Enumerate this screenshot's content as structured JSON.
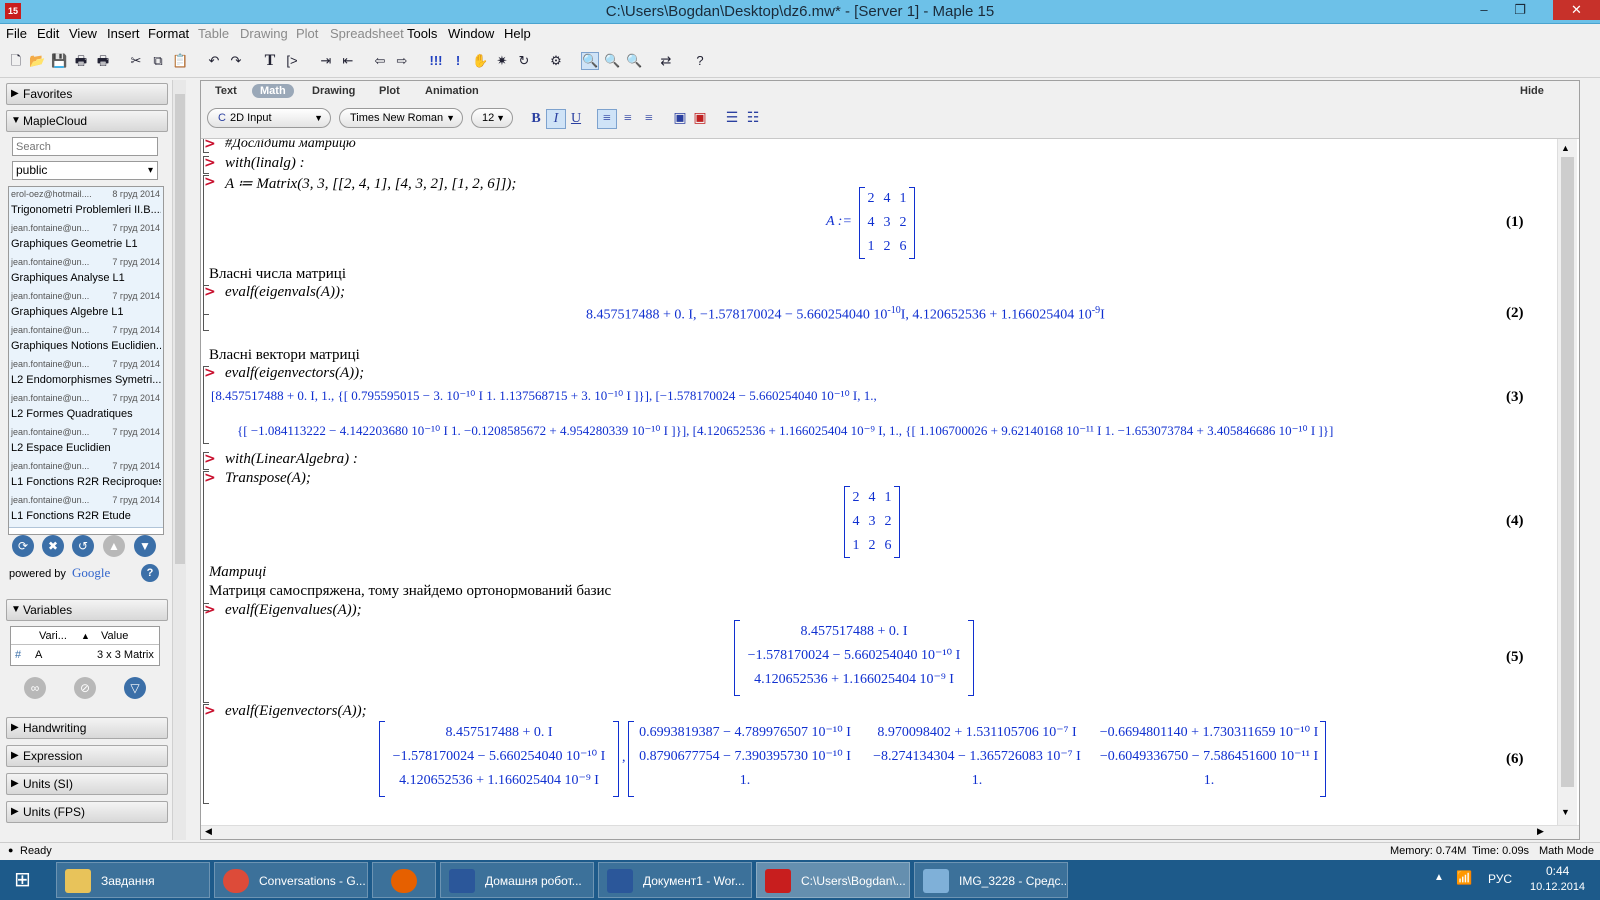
{
  "window": {
    "title": "C:\\Users\\Bogdan\\Desktop\\dz6.mw* - [Server 1] - Maple 15",
    "app_icon": "15",
    "minimize": "–",
    "restore": "❐",
    "close": "✕"
  },
  "menu": [
    "File",
    "Edit",
    "View",
    "Insert",
    "Format",
    "Table",
    "Drawing",
    "Plot",
    "Spreadsheet",
    "Tools",
    "Window",
    "Help"
  ],
  "menu_disabled": [
    "Table",
    "Drawing",
    "Plot",
    "Spreadsheet"
  ],
  "palettes": {
    "favorites": "Favorites",
    "maplecloud": "MapleCloud",
    "search_placeholder": "Search",
    "group": "public",
    "cloud_items": [
      {
        "author": "erol-oez@hotmail....",
        "date": "8 груд 2014",
        "name": "Trigonometri Problemleri II.B...."
      },
      {
        "author": "jean.fontaine@un...",
        "date": "7 груд 2014",
        "name": "Graphiques Geometrie L1"
      },
      {
        "author": "jean.fontaine@un...",
        "date": "7 груд 2014",
        "name": "Graphiques Analyse L1"
      },
      {
        "author": "jean.fontaine@un...",
        "date": "7 груд 2014",
        "name": "Graphiques Algebre L1"
      },
      {
        "author": "jean.fontaine@un...",
        "date": "7 груд 2014",
        "name": "Graphiques Notions Euclidien..."
      },
      {
        "author": "jean.fontaine@un...",
        "date": "7 груд 2014",
        "name": "L2 Endomorphismes Symetri...."
      },
      {
        "author": "jean.fontaine@un...",
        "date": "7 груд 2014",
        "name": "L2 Formes Quadratiques"
      },
      {
        "author": "jean.fontaine@un...",
        "date": "7 груд 2014",
        "name": "L2 Espace Euclidien"
      },
      {
        "author": "jean.fontaine@un...",
        "date": "7 груд 2014",
        "name": "L1 Fonctions R2R Reciproques"
      },
      {
        "author": "jean.fontaine@un...",
        "date": "7 груд 2014",
        "name": "L1 Fonctions R2R Etude"
      }
    ],
    "powered_by": "powered by",
    "google": "Google",
    "variables": "Variables",
    "var_col_name": "Vari...",
    "var_col_value": "Value",
    "var_row": {
      "name": "A",
      "value": "3 x 3 Matrix"
    },
    "handwriting": "Handwriting",
    "expression": "Expression",
    "units_si": "Units (SI)",
    "units_fps": "Units (FPS)"
  },
  "context_bar": {
    "modes": [
      "Text",
      "Math",
      "Drawing",
      "Plot",
      "Animation"
    ],
    "active_mode": "Math",
    "hide": "Hide",
    "input_style": "2D Input",
    "font": "Times New Roman",
    "size": "12",
    "bold": "B",
    "italic": "I",
    "underline": "U"
  },
  "worksheet": {
    "comment": "#Дослідити матрицю",
    "cmd_with_linalg": "with(linalg) :",
    "cmd_matrix": "A ≔ Matrix(3, 3, [[2, 4, 1], [4, 3, 2], [1, 2, 6]]);",
    "out1_lhs": "A :=",
    "matrix_A": [
      [
        "2",
        "4",
        "1"
      ],
      [
        "4",
        "3",
        "2"
      ],
      [
        "1",
        "2",
        "6"
      ]
    ],
    "label1": "(1)",
    "text_eigvals": "Власні числа матриці",
    "cmd_eigvals": "evalf(eigenvals(A));",
    "out2": "8.457517488 + 0. I, −1.578170024 − 5.660254040 10",
    "out2_exp1": "-10",
    "out2_mid": "I, 4.120652536 + 1.166025404 10",
    "out2_exp2": "-9",
    "out2_end": "I",
    "label2": "(2)",
    "text_eigvecs": "Власні вектори матриці",
    "cmd_eigvecs": "evalf(eigenvectors(A));",
    "out3_line1": "[8.457517488 + 0. I, 1., {[ 0.795595015 − 3. 10⁻¹⁰ I  1.  1.137568715 + 3. 10⁻¹⁰ I ]}], [−1.578170024 − 5.660254040 10⁻¹⁰ I, 1.,",
    "out3_line2": "{[ −1.084113222 − 4.142203680 10⁻¹⁰ I  1.  −0.1208585672 + 4.954280339 10⁻¹⁰ I ]}], [4.120652536 + 1.166025404 10⁻⁹ I, 1., {[ 1.106700026 + 9.62140168 10⁻¹¹ I  1.  −1.653073784 + 3.405846686 10⁻¹⁰ I ]}]",
    "label3": "(3)",
    "cmd_with_la": "with(LinearAlgebra) :",
    "cmd_transpose": "Transpose(A);",
    "matrix_T": [
      [
        "2",
        "4",
        "1"
      ],
      [
        "4",
        "3",
        "2"
      ],
      [
        "1",
        "2",
        "6"
      ]
    ],
    "label4": "(4)",
    "text_matrices": "Матриці",
    "text_selfadj": "Матриця самоспряжена, тому знайдемо ортонормований базис",
    "cmd_Eigenvalues": "evalf(Eigenvalues(A));",
    "out5": [
      "8.457517488 + 0. I",
      "−1.578170024 − 5.660254040 10⁻¹⁰ I",
      "4.120652536 + 1.166025404 10⁻⁹ I"
    ],
    "label5": "(5)",
    "cmd_Eigenvectors": "evalf(Eigenvectors(A));",
    "out6_vals": [
      "8.457517488 + 0. I",
      "−1.578170024 − 5.660254040 10⁻¹⁰ I",
      "4.120652536 + 1.166025404 10⁻⁹ I"
    ],
    "out6_vecs": [
      [
        "0.6993819387 − 4.789976507 10⁻¹⁰ I",
        "8.970098402 + 1.531105706 10⁻⁷ I",
        "−0.6694801140 + 1.730311659 10⁻¹⁰ I"
      ],
      [
        "0.8790677754 − 7.390395730 10⁻¹⁰ I",
        "−8.274134304 − 1.365726083 10⁻⁷ I",
        "−0.6049336750 − 7.586451600 10⁻¹¹ I"
      ],
      [
        "1.",
        "1.",
        "1."
      ]
    ],
    "label6": "(6)",
    "out6_sep": ","
  },
  "status": {
    "ready": "Ready",
    "memory": "Memory: 0.74M",
    "time": "Time: 0.09s",
    "mode": "Math Mode"
  },
  "taskbar": {
    "tasks": [
      "Завдання",
      "Conversations - G...",
      "",
      "Домашня робот...",
      "Документ1 - Wor...",
      "C:\\Users\\Bogdan\\...",
      "IMG_3228 - Средс..."
    ],
    "lang": "РУС",
    "time": "0:44",
    "date": "10.12.2014"
  }
}
